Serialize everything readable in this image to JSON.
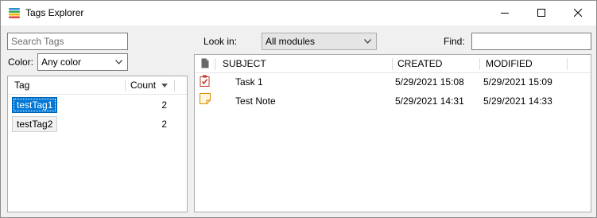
{
  "window": {
    "title": "Tags Explorer",
    "icon": "app-tags-icon",
    "controls": [
      "minimize-icon",
      "maximize-icon",
      "close-icon"
    ]
  },
  "left": {
    "search_placeholder": "Search Tags",
    "color_label": "Color:",
    "color_value": "Any color",
    "columns": {
      "tag": "Tag",
      "count": "Count"
    },
    "tags": [
      {
        "name": "testTag1",
        "count": "2",
        "selected": true
      },
      {
        "name": "testTag2",
        "count": "2",
        "selected": false
      }
    ]
  },
  "right": {
    "lookin_label": "Look in:",
    "lookin_value": "All modules",
    "find_label": "Find:",
    "find_value": "",
    "columns": {
      "subject": "SUBJECT",
      "created": "CREATED",
      "modified": "MODIFIED"
    },
    "items": [
      {
        "icon": "task-icon",
        "subject": "Task 1",
        "created": "5/29/2021 15:08",
        "modified": "5/29/2021 15:09"
      },
      {
        "icon": "note-icon",
        "subject": "Test Note",
        "created": "5/29/2021 14:31",
        "modified": "5/29/2021 14:33"
      }
    ]
  },
  "colors": {
    "selection": "#0078d7",
    "task_icon": "#c0392b",
    "note_icon": "#e08a00"
  }
}
